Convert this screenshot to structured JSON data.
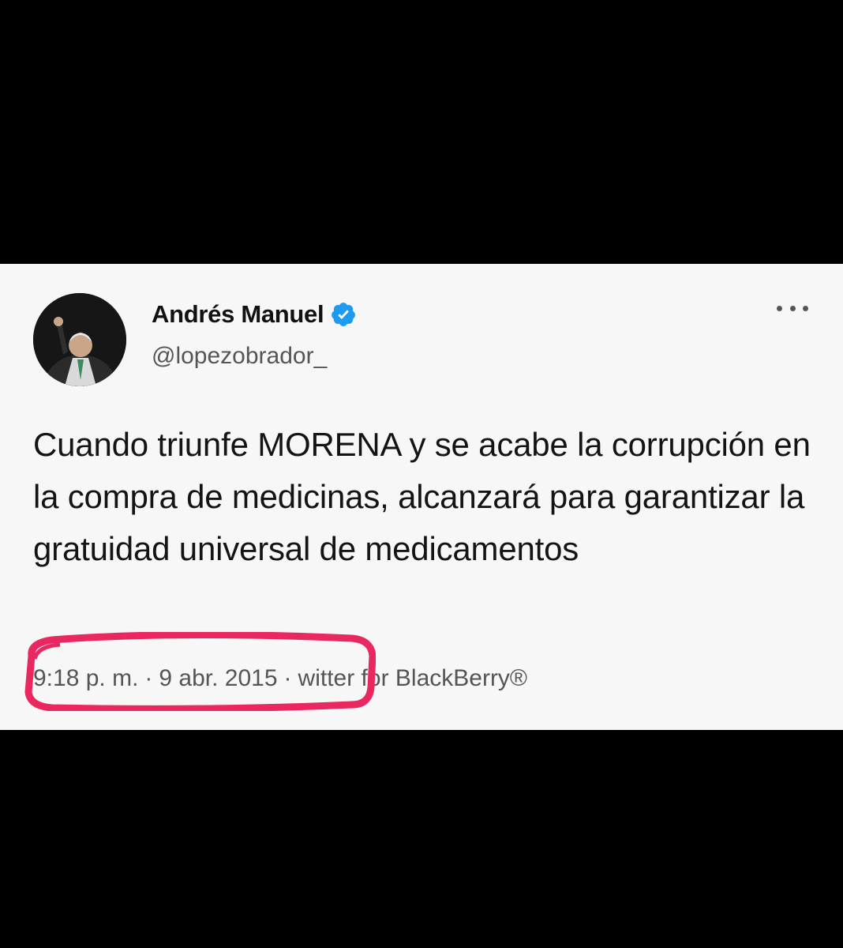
{
  "tweet": {
    "author": {
      "display_name": "Andrés Manuel",
      "handle": "@lopezobrador_",
      "verified": true
    },
    "text": "Cuando triunfe MORENA y se acabe la corrupción en la compra de medicinas, alcanzará para garantizar la gratuidad universal de medicamentos",
    "time": "9:18 p. m.",
    "separator": "·",
    "date": "9 abr. 2015",
    "source": "witter for BlackBerry®"
  },
  "icons": {
    "verified": "verified-badge-icon",
    "more": "more-options-icon"
  },
  "colors": {
    "verified_blue": "#1d9bf0",
    "highlight_red": "#e8285f",
    "card_background": "#f7f7f7"
  }
}
